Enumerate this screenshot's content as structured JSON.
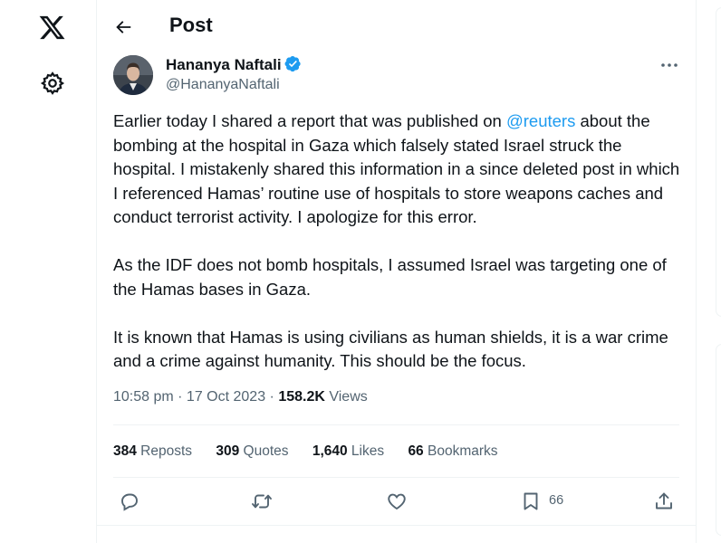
{
  "header": {
    "title": "Post"
  },
  "author": {
    "name": "Hananya Naftali",
    "handle": "@HananyaNaftali"
  },
  "tweet": {
    "p1_before": "Earlier today I shared a report that was published on ",
    "p1_mention": "@reuters",
    "p1_after": " about the bombing at the hospital in Gaza which falsely stated Israel struck the hospital. I mistakenly shared this information in a since deleted post in which I referenced Hamas’ routine use of hospitals to store weapons caches and conduct terrorist activity. I apologize for this error.",
    "p2": "As the IDF does not bomb hospitals, I assumed Israel was targeting one of the Hamas bases in Gaza.",
    "p3": "It is known that Hamas is using civilians as human shields, it is a war crime and a crime against humanity. This should be the focus."
  },
  "meta": {
    "timestamp": "10:58 pm · 17 Oct 2023",
    "separator": " · ",
    "views_count": "158.2K",
    "views_label": " Views"
  },
  "stats": {
    "reposts_count": "384",
    "reposts_label": " Reposts",
    "quotes_count": "309",
    "quotes_label": " Quotes",
    "likes_count": "1,640",
    "likes_label": " Likes",
    "bookmarks_count": "66",
    "bookmarks_label": " Bookmarks"
  },
  "actions": {
    "bookmark_count": "66"
  },
  "colors": {
    "accent": "#1d9bf0",
    "text": "#0f1419",
    "muted": "#536471",
    "border": "#eff3f4"
  }
}
